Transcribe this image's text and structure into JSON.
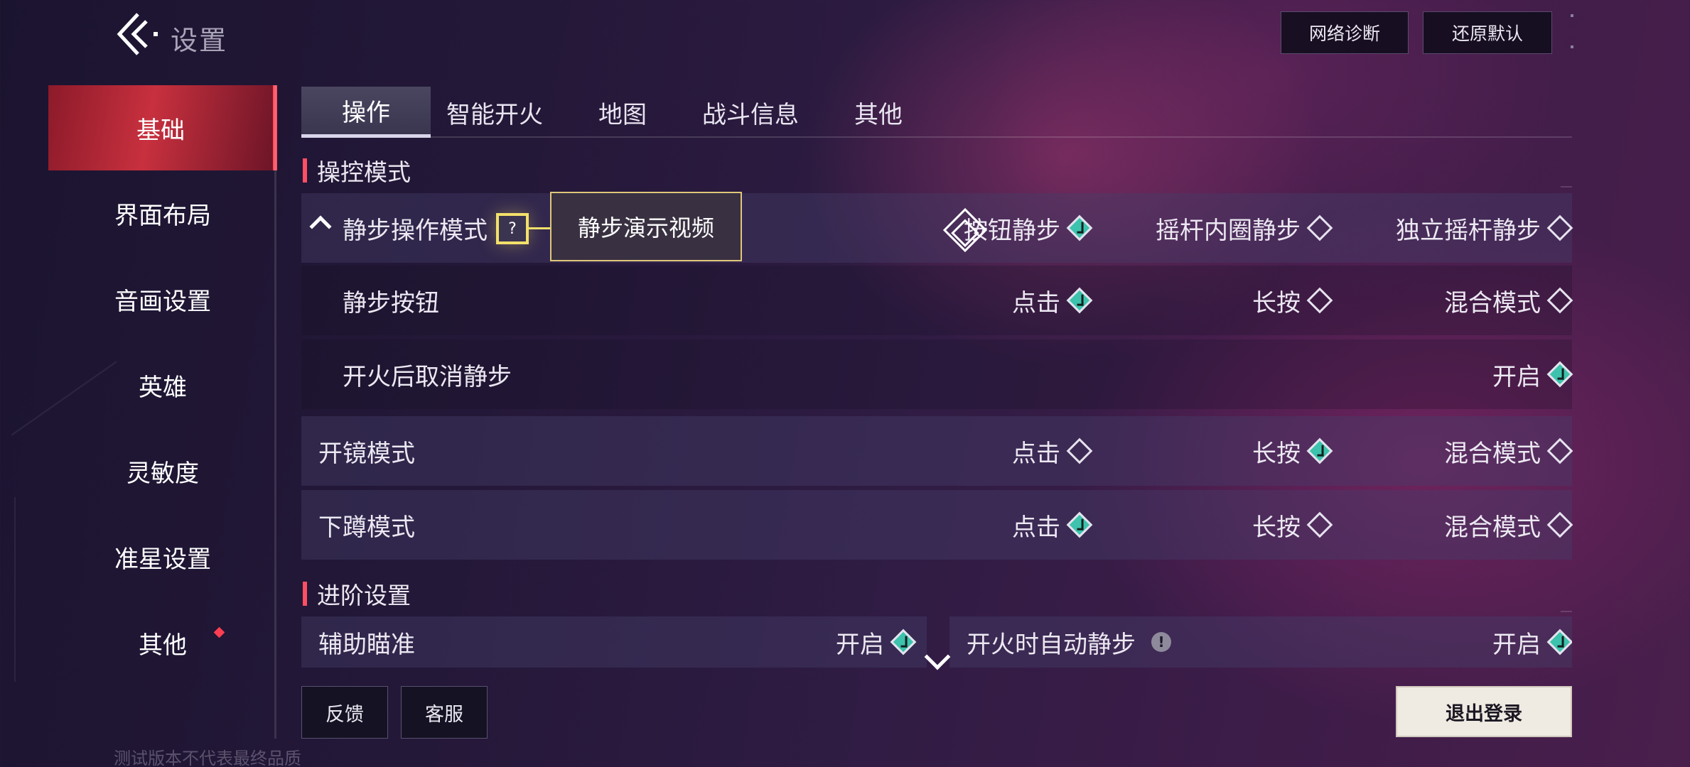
{
  "header": {
    "title": "设置",
    "buttons": {
      "network": "网络诊断",
      "reset": "还原默认"
    }
  },
  "sidebar": {
    "items": [
      {
        "label": "基础",
        "active": true
      },
      {
        "label": "界面布局"
      },
      {
        "label": "音画设置"
      },
      {
        "label": "英雄"
      },
      {
        "label": "灵敏度"
      },
      {
        "label": "准星设置"
      },
      {
        "label": "其他",
        "badge": true
      }
    ]
  },
  "tabs": [
    "操作",
    "智能开火",
    "地图",
    "战斗信息",
    "其他"
  ],
  "active_tab": "操作",
  "sections": {
    "control": "操控模式",
    "advanced": "进阶设置"
  },
  "rows": {
    "silent_mode": {
      "label": "静步操作模式",
      "help": "?",
      "tooltip": "静步演示视频",
      "options": [
        {
          "label": "按钮静步",
          "checked": true
        },
        {
          "label": "摇杆内圈静步",
          "checked": false
        },
        {
          "label": "独立摇杆静步",
          "checked": false
        }
      ]
    },
    "silent_button": {
      "label": "静步按钮",
      "options": [
        {
          "label": "点击",
          "checked": true
        },
        {
          "label": "长按",
          "checked": false
        },
        {
          "label": "混合模式",
          "checked": false
        }
      ]
    },
    "cancel_after_fire": {
      "label": "开火后取消静步",
      "options": [
        {
          "label": "开启",
          "checked": true
        }
      ]
    },
    "scope_mode": {
      "label": "开镜模式",
      "options": [
        {
          "label": "点击",
          "checked": false
        },
        {
          "label": "长按",
          "checked": true
        },
        {
          "label": "混合模式",
          "checked": false
        }
      ]
    },
    "crouch_mode": {
      "label": "下蹲模式",
      "options": [
        {
          "label": "点击",
          "checked": true
        },
        {
          "label": "长按",
          "checked": false
        },
        {
          "label": "混合模式",
          "checked": false
        }
      ]
    },
    "aim_assist": {
      "label": "辅助瞄准",
      "options": [
        {
          "label": "开启",
          "checked": true
        }
      ]
    },
    "auto_silent_on_fire": {
      "label": "开火时自动静步",
      "info": "!",
      "options": [
        {
          "label": "开启",
          "checked": true
        }
      ]
    }
  },
  "footer": {
    "feedback": "反馈",
    "service": "客服",
    "logout": "退出登录",
    "watermark": "测试版本不代表最终品质"
  },
  "colors": {
    "accent_red": "#ff4f63",
    "checked_teal": "#3cc2ad",
    "highlight_yellow": "#f3e06a"
  }
}
